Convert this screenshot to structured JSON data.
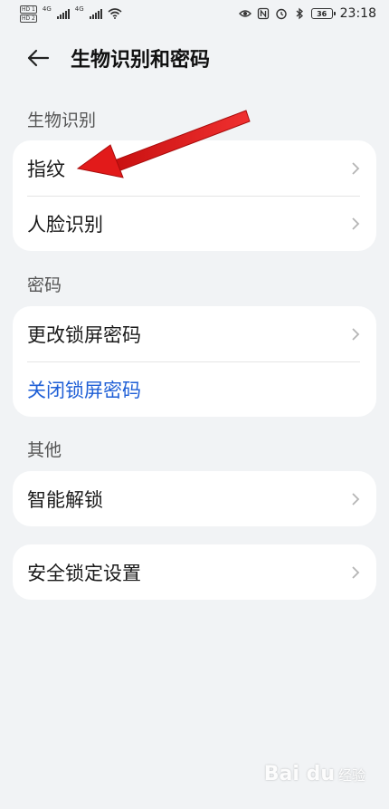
{
  "status_bar": {
    "sim1": "HD 1",
    "sim2": "HD 2",
    "net1": "4G",
    "net2": "4G",
    "battery": "36",
    "time": "23:18"
  },
  "header": {
    "title": "生物识别和密码"
  },
  "sections": {
    "biometrics": {
      "label": "生物识别",
      "items": [
        {
          "label": "指纹"
        },
        {
          "label": "人脸识别"
        }
      ]
    },
    "password": {
      "label": "密码",
      "items": [
        {
          "label": "更改锁屏密码"
        },
        {
          "label": "关闭锁屏密码"
        }
      ]
    },
    "other": {
      "label": "其他",
      "items": [
        {
          "label": "智能解锁"
        }
      ]
    },
    "security_lock": {
      "items": [
        {
          "label": "安全锁定设置"
        }
      ]
    }
  },
  "colors": {
    "background": "#f1f3f5",
    "link_blue": "#1f5fd6",
    "annotation_red": "#e21a1a"
  },
  "icons": [
    "back-arrow-icon",
    "chevron-right-icon",
    "wifi-icon",
    "eye-icon",
    "nfc-icon",
    "alarm-icon",
    "bluetooth-icon",
    "battery-icon"
  ],
  "watermark": {
    "logo": "Bai du",
    "sub": "经验"
  }
}
